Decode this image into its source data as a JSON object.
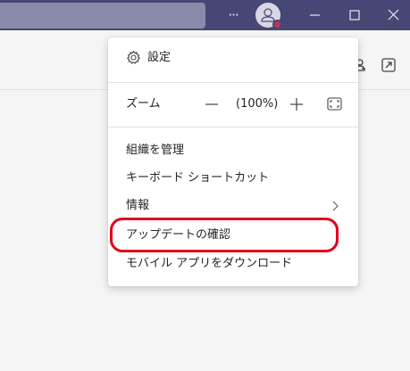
{
  "titlebar": {
    "search": {
      "placeholder": ""
    },
    "more_glyph": "···",
    "avatar": {
      "presence_color": "#c4314b"
    },
    "background": "#464775"
  },
  "menu": {
    "settings_label": "設定",
    "zoom": {
      "label": "ズーム",
      "value": "(100%)"
    },
    "items": [
      {
        "label": "組織を管理"
      },
      {
        "label": "キーボード ショートカット"
      },
      {
        "label": "情報"
      },
      {
        "label": "アップデートの確認"
      },
      {
        "label": "モバイル アプリをダウンロード"
      }
    ]
  },
  "annotation": {
    "color": "#e0001b"
  }
}
